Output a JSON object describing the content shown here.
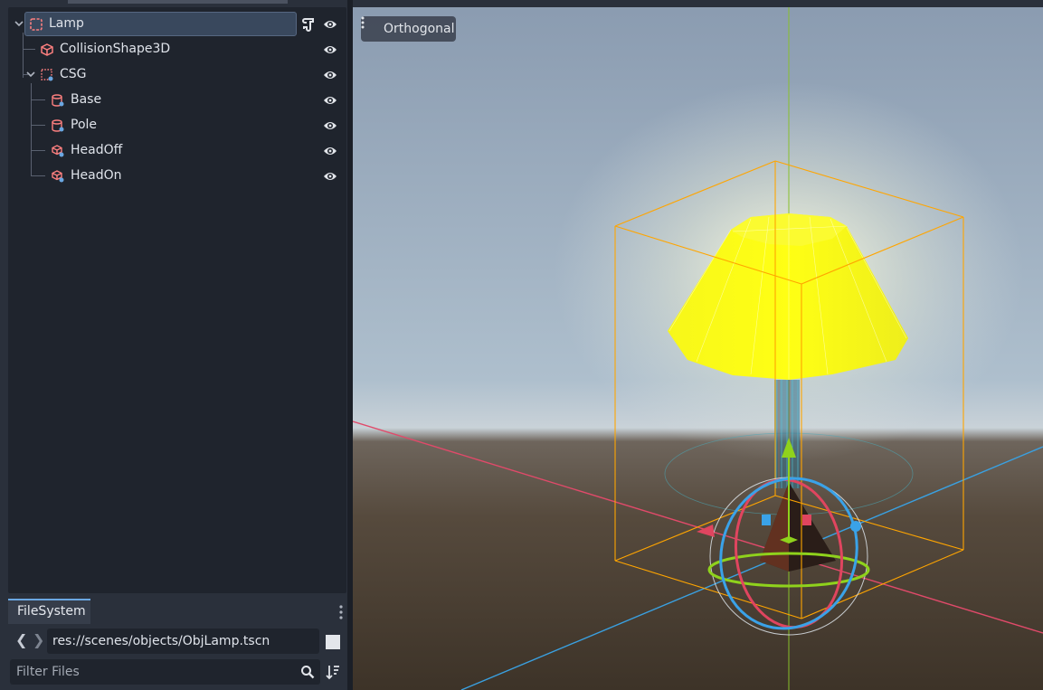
{
  "scene_tree": {
    "nodes": [
      {
        "label": "Lamp",
        "icon": "node3d-icon",
        "selected": true,
        "has_script": true,
        "visible": true
      },
      {
        "label": "CollisionShape3D",
        "icon": "collision-shape-icon",
        "visible": true
      },
      {
        "label": "CSG",
        "icon": "csg-combiner-icon",
        "visible": true
      },
      {
        "label": "Base",
        "icon": "csg-cylinder-icon",
        "visible": true
      },
      {
        "label": "Pole",
        "icon": "csg-cylinder-icon",
        "visible": true
      },
      {
        "label": "HeadOff",
        "icon": "csg-mesh-icon",
        "visible": true
      },
      {
        "label": "HeadOn",
        "icon": "csg-mesh-icon",
        "visible": true
      }
    ]
  },
  "filesystem": {
    "tab_label": "FileSystem",
    "path": "res://scenes/objects/ObjLamp.tscn",
    "filter_placeholder": "Filter Files"
  },
  "viewport": {
    "view_mode_label": "Orthogonal"
  },
  "colors": {
    "accent": "#6aa7e2",
    "node_icon": "#fc7f7f",
    "lamp_shade": "#ffff14",
    "bounding_box": "#ffa500"
  }
}
